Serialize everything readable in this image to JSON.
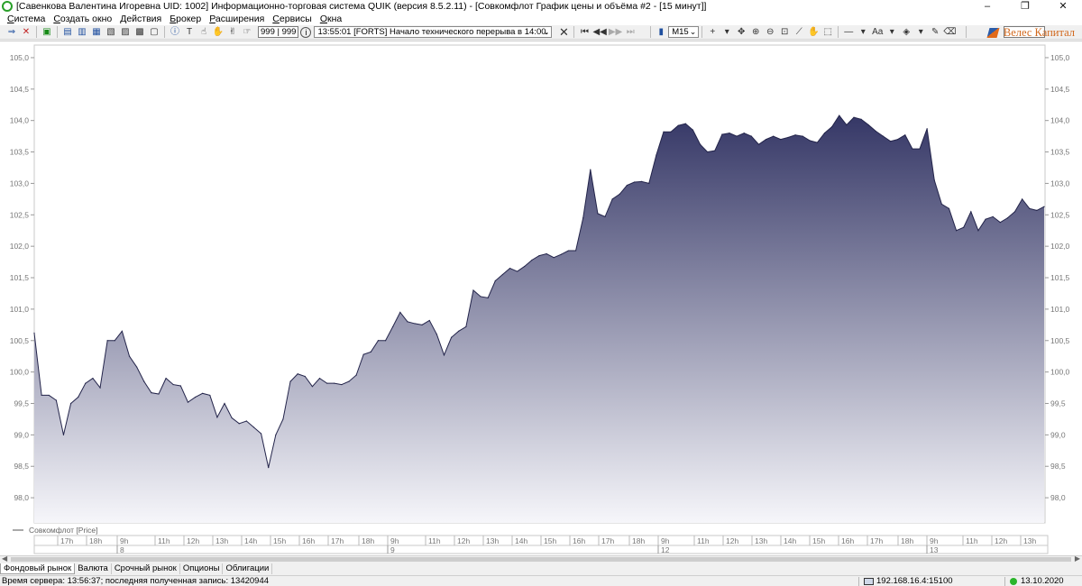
{
  "window": {
    "title": "[Савенкова Валентина Игоревна UID: 1002] Информационно-торговая система QUIK (версия 8.5.2.11) - [Совкомфлот График цены и объёма #2 - [15 минут]]",
    "controls": [
      "–",
      "❐",
      "✕"
    ]
  },
  "menu": [
    {
      "ul": "С",
      "rest": "истема"
    },
    {
      "ul": "С",
      "rest": "оздать окно"
    },
    {
      "ul": "Д",
      "rest": "ействия"
    },
    {
      "ul": "Б",
      "rest": "рокер"
    },
    {
      "ul": "Р",
      "rest": "асширения"
    },
    {
      "ul": "С",
      "rest": "ервисы"
    },
    {
      "ul": "О",
      "rest": "кна"
    }
  ],
  "toolbar": {
    "counter": "999 | 999",
    "message": "13:55:01  [FORTS] Начало технического перерыва в 14:00.",
    "interval": "M15",
    "search_value": "",
    "broker_brand": "Велес Капитал"
  },
  "chart": {
    "legend_label": "Совкомфлот [Price]",
    "colors": {
      "fill_top": "#353766",
      "fill_bottom": "#f6f6fa",
      "line": "#23244a"
    }
  },
  "chart_data": {
    "type": "area",
    "title": "",
    "xlabel": "",
    "ylabel": "",
    "ylim": [
      97.6,
      105.2
    ],
    "y_ticks": [
      "105,0",
      "104,5",
      "104,0",
      "103,5",
      "103,0",
      "102,5",
      "102,0",
      "101,5",
      "101,0",
      "100,5",
      "100,0",
      "99,5",
      "99,0",
      "98,5",
      "98,0"
    ],
    "x_time_ticks": [
      "17h",
      "18h",
      "9h",
      "11h",
      "12h",
      "13h",
      "14h",
      "15h",
      "16h",
      "17h",
      "18h",
      "9h",
      "11h",
      "12h",
      "13h",
      "14h",
      "15h",
      "16h",
      "17h",
      "18h",
      "9h",
      "11h",
      "12h",
      "13h",
      "14h",
      "15h",
      "16h",
      "17h",
      "18h",
      "9h",
      "11h",
      "12h",
      "13h"
    ],
    "x_date_ticks": [
      "8",
      "9",
      "12",
      "13"
    ],
    "series": [
      {
        "name": "Совкомфлот [Price]",
        "values": [
          100.62,
          99.63,
          99.63,
          99.55,
          99.0,
          99.5,
          99.6,
          99.82,
          99.9,
          99.75,
          100.5,
          100.5,
          100.65,
          100.25,
          100.08,
          99.85,
          99.67,
          99.65,
          99.9,
          99.8,
          99.78,
          99.52,
          99.6,
          99.66,
          99.63,
          99.28,
          99.5,
          99.27,
          99.18,
          99.22,
          99.12,
          99.02,
          98.48,
          99.0,
          99.25,
          99.85,
          99.97,
          99.93,
          99.77,
          99.9,
          99.82,
          99.82,
          99.8,
          99.85,
          99.95,
          100.28,
          100.32,
          100.5,
          100.5,
          100.72,
          100.95,
          100.8,
          100.77,
          100.75,
          100.82,
          100.6,
          100.27,
          100.55,
          100.65,
          100.72,
          101.3,
          101.2,
          101.18,
          101.45,
          101.55,
          101.65,
          101.6,
          101.68,
          101.78,
          101.85,
          101.88,
          101.82,
          101.87,
          101.93,
          101.93,
          102.45,
          103.22,
          102.52,
          102.47,
          102.75,
          102.83,
          102.97,
          103.02,
          103.03,
          103.0,
          103.45,
          103.82,
          103.82,
          103.92,
          103.95,
          103.85,
          103.62,
          103.5,
          103.52,
          103.78,
          103.8,
          103.75,
          103.8,
          103.75,
          103.62,
          103.7,
          103.75,
          103.7,
          103.73,
          103.77,
          103.75,
          103.68,
          103.65,
          103.8,
          103.9,
          104.08,
          103.93,
          104.05,
          104.02,
          103.93,
          103.83,
          103.75,
          103.67,
          103.7,
          103.77,
          103.55,
          103.55,
          103.87,
          103.05,
          102.67,
          102.6,
          102.25,
          102.3,
          102.55,
          102.25,
          102.43,
          102.47,
          102.38,
          102.45,
          102.55,
          102.75,
          102.6,
          102.57,
          102.63
        ]
      }
    ],
    "grid": false,
    "legend_position": "bottom-left"
  },
  "market_tabs": [
    {
      "label": "Фондовый рынок",
      "active": true
    },
    {
      "label": "Валюта",
      "active": false
    },
    {
      "label": "Срочный рынок",
      "active": false
    },
    {
      "label": "Опционы",
      "active": false
    },
    {
      "label": "Облигации",
      "active": false
    }
  ],
  "status": {
    "server_time": "Время сервера: 13:56:37; последняя полученная запись: 13420944",
    "connection": "192.168.16.4:15100",
    "date": "13.10.2020"
  }
}
